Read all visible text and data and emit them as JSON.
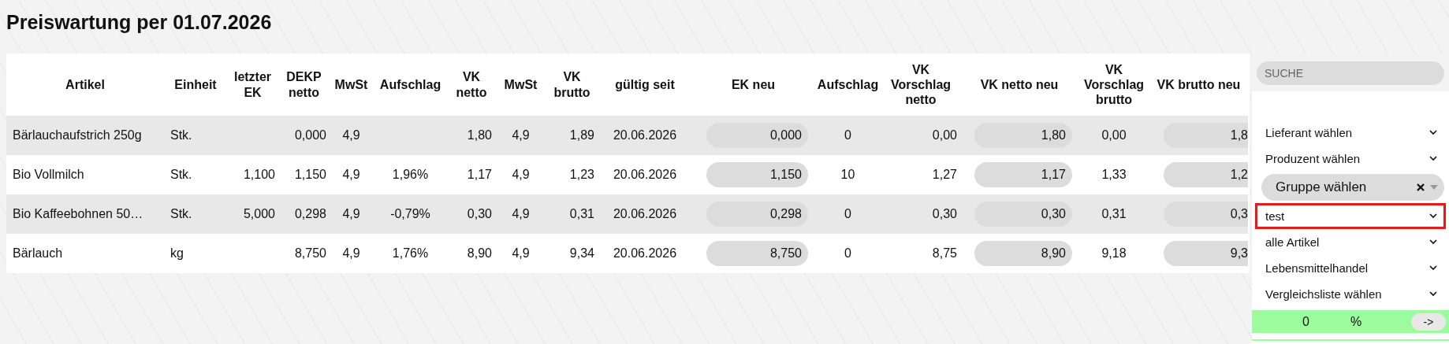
{
  "title": "Preiswartung per 01.07.2026",
  "table": {
    "columns": [
      {
        "label": "Artikel",
        "kind": "text"
      },
      {
        "label": "Einheit",
        "kind": "text"
      },
      {
        "label": "letzter EK",
        "kind": "num"
      },
      {
        "label": "DEKP netto",
        "kind": "num"
      },
      {
        "label": "MwSt",
        "kind": "center"
      },
      {
        "label": "Aufschlag",
        "kind": "center"
      },
      {
        "label": "VK netto",
        "kind": "num"
      },
      {
        "label": "MwSt",
        "kind": "center"
      },
      {
        "label": "VK brutto",
        "kind": "num"
      },
      {
        "label": "gültig seit",
        "kind": "center"
      },
      {
        "label": "EK neu",
        "kind": "input"
      },
      {
        "label": "Aufschlag",
        "kind": "center"
      },
      {
        "label": "VK Vorschlag netto",
        "kind": "num"
      },
      {
        "label": "VK netto neu",
        "kind": "input"
      },
      {
        "label": "VK Vorschlag brutto",
        "kind": "center"
      },
      {
        "label": "VK brutto neu",
        "kind": "input"
      }
    ],
    "rows": [
      [
        "Bärlauchaufstrich 250g",
        "Stk.",
        "",
        "0,000",
        "4,9",
        "",
        "1,80",
        "4,9",
        "1,89",
        "20.06.2026",
        "0,000",
        "0",
        "0,00",
        "1,80",
        "0,00",
        "1,8"
      ],
      [
        "Bio Vollmilch",
        "Stk.",
        "1,100",
        "1,150",
        "4,9",
        "1,96%",
        "1,17",
        "4,9",
        "1,23",
        "20.06.2026",
        "1,150",
        "10",
        "1,27",
        "1,17",
        "1,33",
        "1,2"
      ],
      [
        "Bio Kaffeebohnen 50…",
        "Stk.",
        "5,000",
        "0,298",
        "4,9",
        "-0,79%",
        "0,30",
        "4,9",
        "0,31",
        "20.06.2026",
        "0,298",
        "0",
        "0,30",
        "0,30",
        "0,31",
        "0,3"
      ],
      [
        "Bärlauch",
        "kg",
        "",
        "8,750",
        "4,9",
        "1,76%",
        "8,90",
        "4,9",
        "9,34",
        "20.06.2026",
        "8,750",
        "0",
        "8,75",
        "8,90",
        "9,18",
        "9,3"
      ]
    ]
  },
  "sidebar": {
    "search": {
      "placeholder": "SUCHE"
    },
    "dropdowns": [
      {
        "kind": "select",
        "label": "Lieferant wählen",
        "highlighted": false
      },
      {
        "kind": "select",
        "label": "Produzent wählen",
        "highlighted": false
      },
      {
        "kind": "combo",
        "label": "Gruppe wählen",
        "highlighted": false
      },
      {
        "kind": "select",
        "label": "test",
        "highlighted": true
      },
      {
        "kind": "select",
        "label": "alle Artikel",
        "highlighted": false
      },
      {
        "kind": "select",
        "label": "Lebensmittelhandel",
        "highlighted": false
      },
      {
        "kind": "select",
        "label": "Vergleichsliste wählen",
        "highlighted": false
      }
    ],
    "percent_bar": {
      "value": "0",
      "unit": "%",
      "button": "->"
    }
  }
}
